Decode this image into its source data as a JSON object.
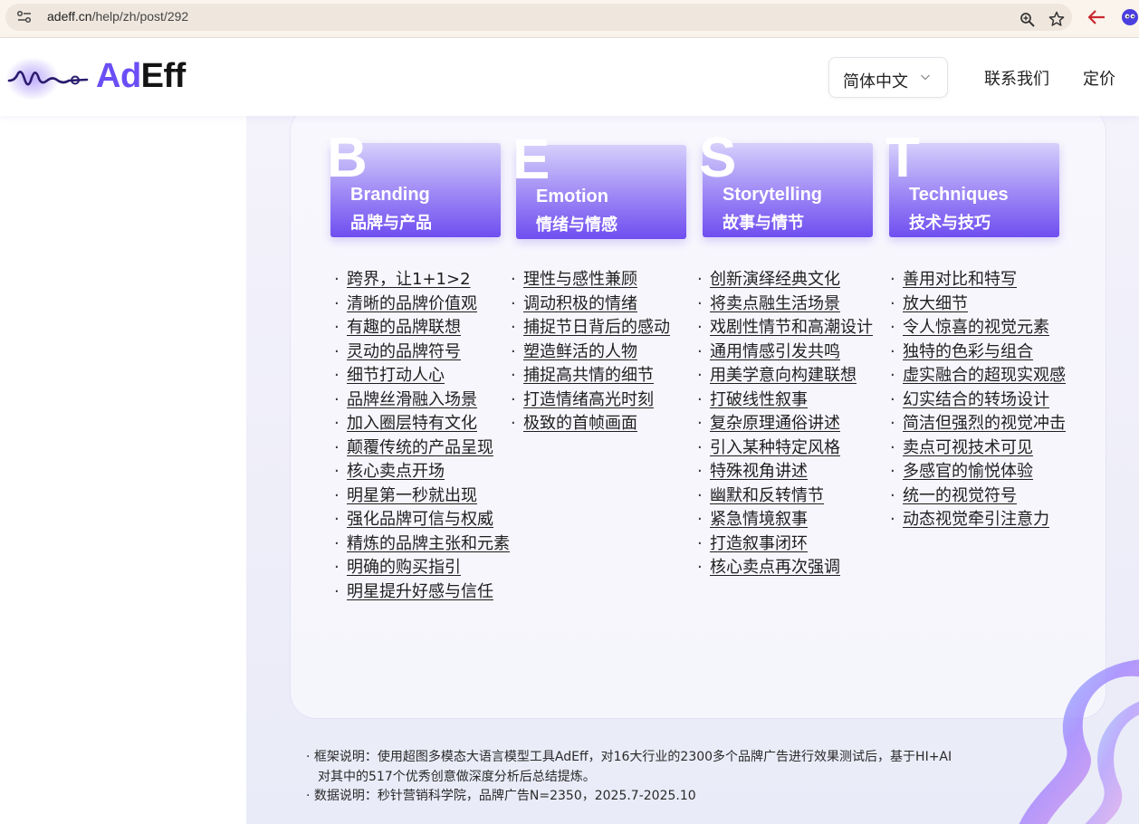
{
  "browser": {
    "url_host": "adeff.cn",
    "url_path": "/help/zh/post/292",
    "icons": [
      "site-info-icon",
      "zoom-icon",
      "star-icon",
      "back-arrow-icon",
      "extension-icon"
    ]
  },
  "header": {
    "logo_ad": "Ad",
    "logo_eff": "Eff",
    "language_select": {
      "selected": "简体中文"
    },
    "nav": {
      "contact": "联系我们",
      "pricing": "定价"
    }
  },
  "framework": {
    "columns": [
      {
        "letter": "B",
        "en": "Branding",
        "zh": "品牌与产品",
        "items": [
          "跨界，让1+1>2",
          "清晰的品牌价值观",
          "有趣的品牌联想",
          "灵动的品牌符号",
          "细节打动人心",
          "品牌丝滑融入场景",
          "加入圈层特有文化",
          "颠覆传统的产品呈现",
          "核心卖点开场",
          "明星第一秒就出现",
          "强化品牌可信与权威",
          "精炼的品牌主张和元素",
          "明确的购买指引",
          "明星提升好感与信任"
        ]
      },
      {
        "letter": "E",
        "en": "Emotion",
        "zh": "情绪与情感",
        "items": [
          "理性与感性兼顾",
          "调动积极的情绪",
          "捕捉节日背后的感动",
          "塑造鲜活的人物",
          "捕捉高共情的细节",
          "打造情绪高光时刻",
          "极致的首帧画面"
        ]
      },
      {
        "letter": "S",
        "en": "Storytelling",
        "zh": "故事与情节",
        "items": [
          "创新演绎经典文化",
          "将卖点融生活场景",
          "戏剧性情节和高潮设计",
          "通用情感引发共鸣",
          "用美学意向构建联想",
          "打破线性叙事",
          "复杂原理通俗讲述",
          "引入某种特定风格",
          "特殊视角讲述",
          "幽默和反转情节",
          "紧急情境叙事",
          "打造叙事闭环",
          "核心卖点再次强调"
        ]
      },
      {
        "letter": "T",
        "en": "Techniques",
        "zh": "技术与技巧",
        "items": [
          "善用对比和特写",
          "放大细节",
          "令人惊喜的视觉元素",
          "独特的色彩与组合",
          "虚实融合的超现实观感",
          "幻实结合的转场设计",
          "简洁但强烈的视觉冲击",
          "卖点可视技术可见",
          "多感官的愉悦体验",
          "统一的视觉符号",
          "动态视觉牵引注意力"
        ]
      }
    ],
    "bullet": "·"
  },
  "footnotes": {
    "line1": "· 框架说明：使用超图多模态大语言模型工具AdEff，对16大行业的2300多个品牌广告进行效果测试后，基于HI+AI",
    "line2": "对其中的517个优秀创意做深度分析后总结提炼。",
    "line3": "· 数据说明：秒针营销科学院，品牌广告N=2350，2025.7-2025.10"
  },
  "colors": {
    "brand_purple": "#6b4ef5",
    "card_gradient_top": "#d6d0fb",
    "card_gradient_bottom": "#6f4ef0"
  }
}
